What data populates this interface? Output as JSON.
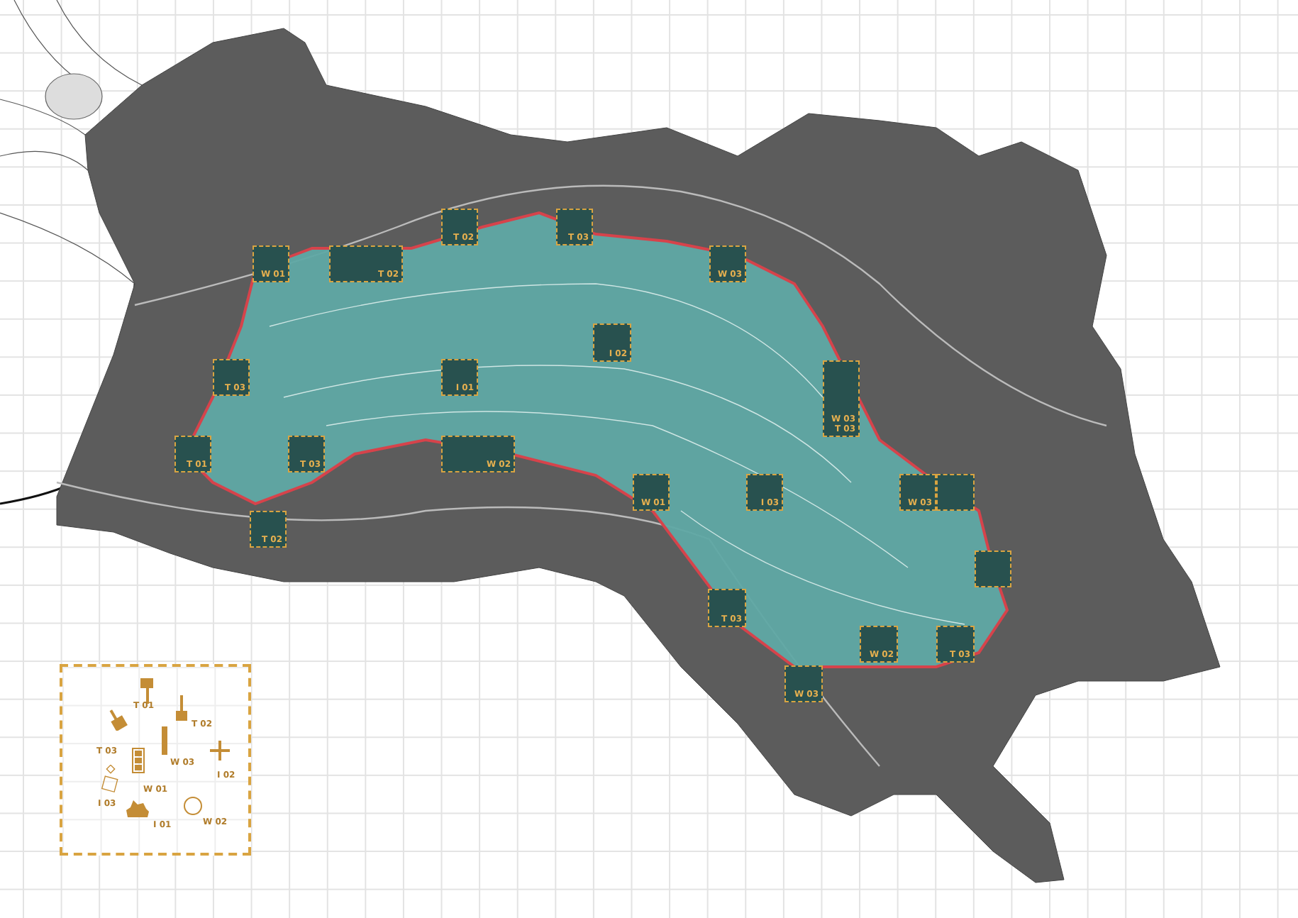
{
  "map": {
    "markers": [
      {
        "labels": [
          "W 01"
        ]
      },
      {
        "labels": [
          "T 02"
        ]
      },
      {
        "labels": [
          "T 02"
        ]
      },
      {
        "labels": [
          "T 03"
        ]
      },
      {
        "labels": [
          "W 03"
        ]
      },
      {
        "labels": [
          "T 03"
        ]
      },
      {
        "labels": [
          "I 01"
        ]
      },
      {
        "labels": [
          "I 02"
        ]
      },
      {
        "labels": [
          "W 03",
          "T 03"
        ]
      },
      {
        "labels": [
          "T 01"
        ]
      },
      {
        "labels": [
          "T 03"
        ]
      },
      {
        "labels": [
          "W 02"
        ]
      },
      {
        "labels": [
          "T 02"
        ]
      },
      {
        "labels": [
          "W 01"
        ]
      },
      {
        "labels": [
          "I 03"
        ]
      },
      {
        "labels": [
          "W 03"
        ]
      },
      {
        "kind": "photo-tile"
      },
      {
        "kind": "photo-tile"
      },
      {
        "labels": [
          "T 03"
        ]
      },
      {
        "labels": [
          "W 02"
        ]
      },
      {
        "labels": [
          "T 03"
        ]
      },
      {
        "labels": [
          "W 03"
        ]
      }
    ]
  },
  "legend": {
    "items": [
      {
        "kind": "signpost",
        "label": "T 01"
      },
      {
        "kind": "post",
        "label": "T 02"
      },
      {
        "kind": "board",
        "label": "T 03"
      },
      {
        "kind": "bar",
        "label": "W 03"
      },
      {
        "kind": "cross",
        "label": "I 02"
      },
      {
        "kind": "stack",
        "label": "W 01"
      },
      {
        "kind": "diamond",
        "label": "I 03"
      },
      {
        "kind": "blob",
        "label": "I 01"
      },
      {
        "kind": "ring",
        "label": "W 02"
      }
    ]
  }
}
